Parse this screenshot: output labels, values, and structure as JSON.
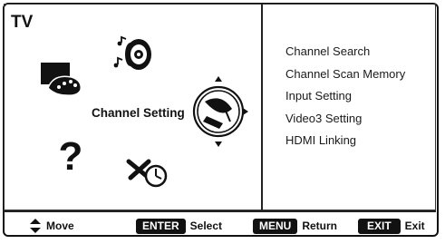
{
  "screen": {
    "title": "TV"
  },
  "center": {
    "selected_label": "Channel Setting"
  },
  "menu": {
    "items": [
      {
        "label": "Channel Search"
      },
      {
        "label": "Channel Scan Memory"
      },
      {
        "label": "Input Setting"
      },
      {
        "label": "Video3 Setting"
      },
      {
        "label": "HDMI Linking"
      }
    ]
  },
  "footer": {
    "move_label": "Move",
    "enter_key": "ENTER",
    "enter_label": "Select",
    "menu_key": "MENU",
    "menu_label": "Return",
    "exit_key": "EXIT",
    "exit_label": "Exit"
  },
  "icons": {
    "sound": "speaker-music-icon",
    "picture": "picture-adjust-icon",
    "help": "question-mark-icon",
    "setup": "tools-clock-icon",
    "channel": "satellite-dish-icon"
  }
}
